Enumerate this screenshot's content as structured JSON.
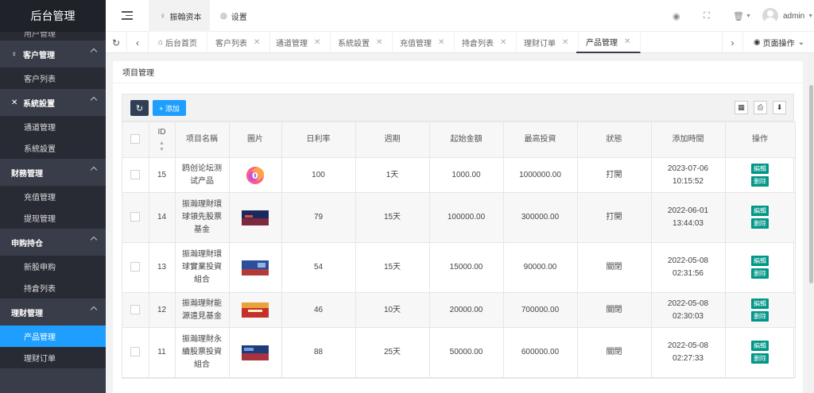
{
  "sidebar": {
    "logo": "后台管理",
    "partial_item": "用户管理",
    "groups": [
      {
        "icon": "user-icon",
        "glyph": "♀",
        "label": "客户管理",
        "items": [
          "客户列表"
        ]
      },
      {
        "icon": "cross-tools-icon",
        "glyph": "✕",
        "label": "系統設置",
        "items": [
          "通道管理",
          "系統設置"
        ]
      },
      {
        "icon": "",
        "glyph": "",
        "label": "财務管理",
        "items": [
          "充值管理",
          "提现管理"
        ]
      },
      {
        "icon": "",
        "glyph": "",
        "label": "申购持仓",
        "items": [
          "新股申购",
          "持倉列表"
        ]
      },
      {
        "icon": "",
        "glyph": "",
        "label": "理财管理",
        "items": [
          "产品管理",
          "理财订单"
        ]
      }
    ]
  },
  "header": {
    "tab_active": "振翰资本",
    "tab_settings": "设置",
    "user": "admin"
  },
  "tabs": {
    "items": [
      "后台首页",
      "客户列表",
      "通道管理",
      "系統設置",
      "充值管理",
      "持倉列表",
      "理财订单",
      "产品管理"
    ],
    "page_ops": "页面操作"
  },
  "main": {
    "title": "项目管理",
    "add_label": "+ 添加",
    "columns": [
      "ID",
      "项目名稱",
      "圖片",
      "日利率",
      "週期",
      "起始金額",
      "最高投資",
      "狀態",
      "添加時間",
      "操作"
    ],
    "edit_label": "編輯",
    "delete_label": "删除",
    "rows": [
      {
        "id": "15",
        "name": "鸥创论坛测试产品",
        "rate": "100",
        "period": "1天",
        "min": "1000.00",
        "max": "1000000.00",
        "status": "打開",
        "date": "2023-07-06",
        "time": "10:15:52"
      },
      {
        "id": "14",
        "name": "振瀚理財環球領先股票基金",
        "rate": "79",
        "period": "15天",
        "min": "100000.00",
        "max": "300000.00",
        "status": "打開",
        "date": "2022-06-01",
        "time": "13:44:03"
      },
      {
        "id": "13",
        "name": "振瀚理財環球實業投資組合",
        "rate": "54",
        "period": "15天",
        "min": "15000.00",
        "max": "90000.00",
        "status": "關閉",
        "date": "2022-05-08",
        "time": "02:31:56"
      },
      {
        "id": "12",
        "name": "振瀚理財能源遠見基金",
        "rate": "46",
        "period": "10天",
        "min": "20000.00",
        "max": "700000.00",
        "status": "關閉",
        "date": "2022-05-08",
        "time": "02:30:03"
      },
      {
        "id": "11",
        "name": "振瀚理財永續股票投資組合",
        "rate": "88",
        "period": "25天",
        "min": "50000.00",
        "max": "600000.00",
        "status": "關閉",
        "date": "2022-05-08",
        "time": "02:27:33"
      }
    ]
  }
}
